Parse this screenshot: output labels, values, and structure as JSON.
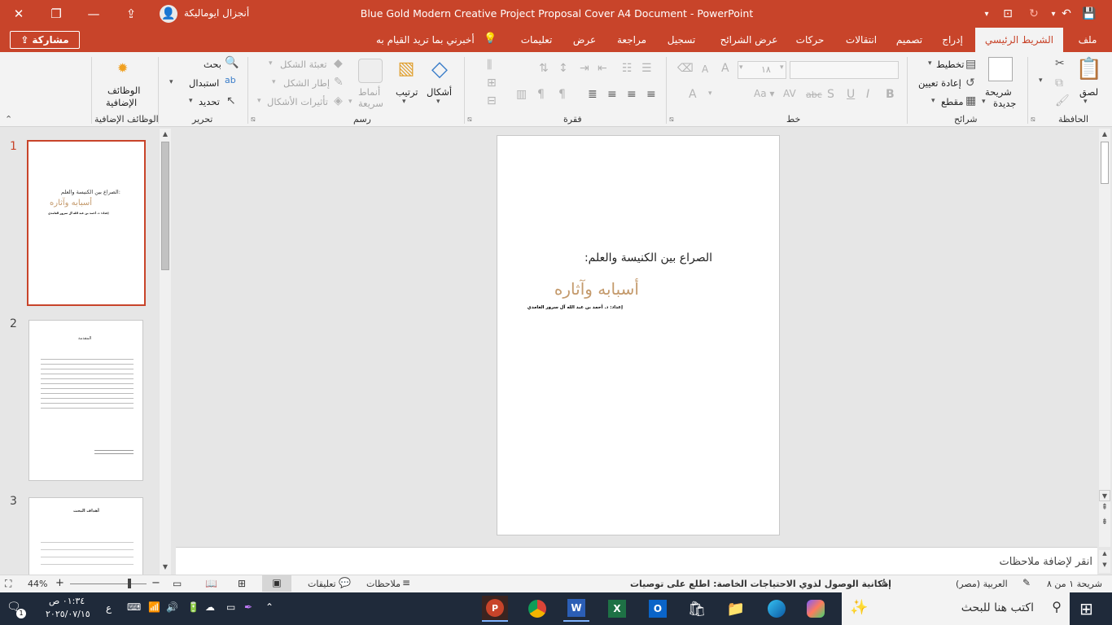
{
  "window": {
    "title": "Blue Gold Modern Creative Project Proposal Cover A4 Document  -  PowerPoint",
    "user": "أنجزال ايوماليكة",
    "accent": "#c8442a"
  },
  "tabs": [
    "ملف",
    "الشريط الرئيسي",
    "إدراج",
    "تصميم",
    "انتقالات",
    "حركات",
    "عرض الشرائح",
    "تسجيل",
    "مراجعة",
    "عرض",
    "تعليمات"
  ],
  "tell_me": "أخبرني بما تريد القيام به",
  "share_label": "مشاركة",
  "ribbon": {
    "clipboard": {
      "label": "الحافظة",
      "paste": "لصق"
    },
    "slides": {
      "label": "شرائح",
      "new_slide_1": "شريحة",
      "new_slide_2": "جديدة",
      "layout": "تخطيط",
      "reset": "إعادة تعيين",
      "section": "مقطع"
    },
    "font": {
      "label": "خط",
      "size": "١٨"
    },
    "paragraph": {
      "label": "فقرة"
    },
    "drawing": {
      "label": "رسم",
      "shapes": "أشكال",
      "arrange": "ترتيب",
      "quick_styles_1": "أنماط",
      "quick_styles_2": "سريعة",
      "fill": "تعبئة الشكل",
      "outline": "إطار الشكل",
      "effects": "تأثيرات الأشكال"
    },
    "editing": {
      "label": "تحرير",
      "find": "بحث",
      "replace": "استبدال",
      "select": "تحديد"
    },
    "addins": {
      "label": "الوظائف الإضافية",
      "button_1": "الوظائف",
      "button_2": "الإضافية"
    }
  },
  "thumbnails": [
    {
      "number": "1",
      "line1": "الصراع بين الكنيسة والعلم:",
      "line2": "أسبابه وآثاره",
      "line3": "إعداد: د. أحمد بن عبد الله آل سرور الغامدي"
    },
    {
      "number": "2",
      "line1": "المقدمة"
    },
    {
      "number": "3",
      "line1": "أهداف البحث"
    }
  ],
  "slide": {
    "title": "الصراع بين الكنيسة والعلم:",
    "subtitle": "أسبابه وآثاره",
    "author": "إعداد: د. أحمد بن عبد الله آل سرور الغامدي",
    "subtitle_color": "#c49a6c"
  },
  "notes_placeholder": "انقر لإضافة ملاحظات",
  "status": {
    "slide_count": "شريحة ١ من ٨",
    "language": "العربية (مصر)",
    "accessibility": "إمكانية الوصول لذوي الاحتياجات الخاصة: اطلع على توصيات",
    "notes": "ملاحظات",
    "comments": "تعليقات",
    "zoom": "44%"
  },
  "taskbar": {
    "search_placeholder": "اكتب هنا للبحث",
    "time": "٠١:٣٤ ص",
    "date": "٢٠٢٥/٠٧/١٥",
    "lang": "ع",
    "notif_count": "1"
  }
}
